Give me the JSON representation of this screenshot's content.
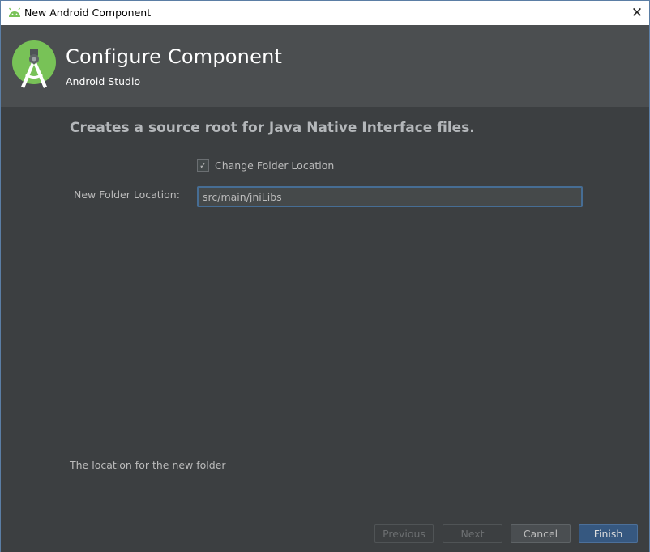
{
  "window": {
    "title": "New Android Component",
    "close_glyph": "✕"
  },
  "header": {
    "title": "Configure Component",
    "subtitle": "Android Studio"
  },
  "content": {
    "description": "Creates a source root for Java Native Interface files.",
    "checkbox": {
      "label": "Change Folder Location",
      "checked": true,
      "glyph": "✓"
    },
    "field": {
      "label": "New Folder Location:",
      "value": "src/main/jniLibs"
    },
    "help_text": "The location for the new folder"
  },
  "buttons": {
    "previous": "Previous",
    "next": "Next",
    "cancel": "Cancel",
    "finish": "Finish"
  },
  "icons": {
    "app": "android-icon",
    "logo": "android-studio-logo-icon",
    "close": "close-icon",
    "check": "check-icon"
  },
  "colors": {
    "body_bg": "#3c3f41",
    "header_bg": "#4b4e50",
    "accent": "#365880",
    "android_green": "#78c257"
  }
}
